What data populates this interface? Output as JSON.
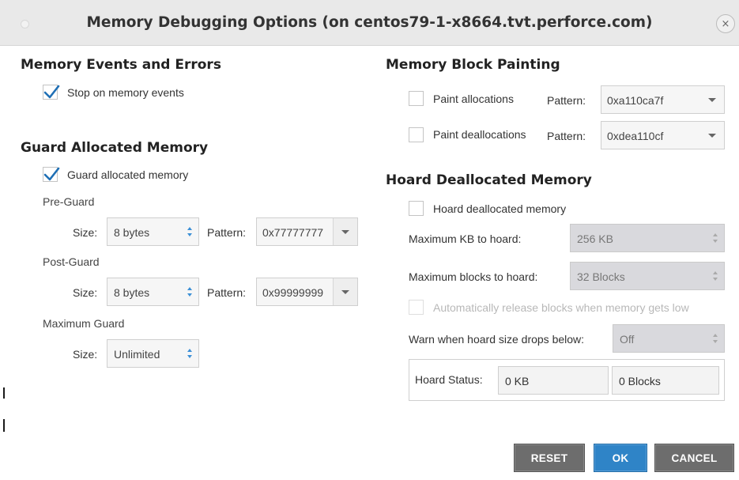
{
  "dialog": {
    "title": "Memory Debugging Options (on centos79-1-x8664.tvt.perforce.com)",
    "close_glyph": "×"
  },
  "events": {
    "section_title": "Memory Events and Errors",
    "stop_on_events_label": "Stop on memory events",
    "stop_on_events_checked": true
  },
  "guard": {
    "section_title": "Guard Allocated Memory",
    "guard_label": "Guard allocated memory",
    "guard_checked": true,
    "pre_guard_title": "Pre-Guard",
    "post_guard_title": "Post-Guard",
    "max_guard_title": "Maximum Guard",
    "size_label": "Size:",
    "pattern_label": "Pattern:",
    "pre_size": "8 bytes",
    "pre_pattern": "0x77777777",
    "post_size": "8 bytes",
    "post_pattern": "0x99999999",
    "max_size": "Unlimited"
  },
  "painting": {
    "section_title": "Memory Block Painting",
    "paint_alloc_label": "Paint allocations",
    "paint_alloc_checked": false,
    "paint_dealloc_label": "Paint deallocations",
    "paint_dealloc_checked": false,
    "pattern_label": "Pattern:",
    "alloc_pattern": "0xa110ca7f",
    "dealloc_pattern": "0xdea110cf"
  },
  "hoard": {
    "section_title": "Hoard Deallocated Memory",
    "hoard_label": "Hoard deallocated memory",
    "hoard_checked": false,
    "max_kb_label": "Maximum KB to hoard:",
    "max_kb_value": "256 KB",
    "max_blocks_label": "Maximum blocks to hoard:",
    "max_blocks_value": "32 Blocks",
    "auto_release_label": "Automatically release blocks when memory gets low",
    "auto_release_checked": false,
    "warn_label": "Warn when hoard size drops below:",
    "warn_value": "Off",
    "status_label": "Hoard Status:",
    "status_kb": "0 KB",
    "status_blocks": "0 Blocks"
  },
  "buttons": {
    "reset": "RESET",
    "ok": "OK",
    "cancel": "CANCEL"
  },
  "colors": {
    "checkbox_check": "#1f6fb5",
    "ok_button": "#2f84c7",
    "secondary_button": "#6d6d6d",
    "titlebar": "#e9e9e9"
  },
  "icons": {
    "check": "check-icon",
    "spinner": "up-down-arrows-icon",
    "combo": "chevron-down-icon",
    "close": "close-icon"
  }
}
